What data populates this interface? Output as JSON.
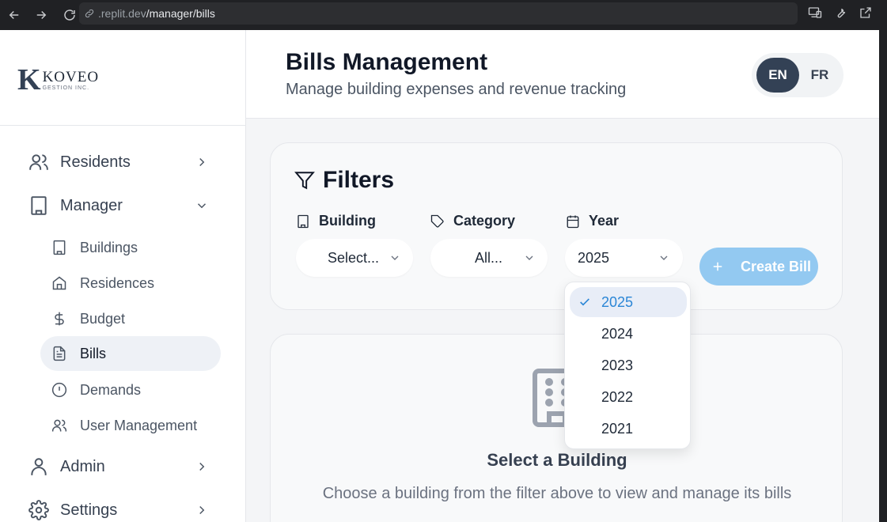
{
  "browser": {
    "url_host": ".replit.dev",
    "url_path": "/manager/bills"
  },
  "logo": {
    "mark": "K",
    "name": "KOVEO",
    "sub": "GESTION INC."
  },
  "sidebar": {
    "sections": [
      {
        "label": "Residents",
        "icon": "users-icon",
        "expanded": false
      },
      {
        "label": "Manager",
        "icon": "building-icon",
        "expanded": true
      },
      {
        "label": "Admin",
        "icon": "user-icon",
        "expanded": false
      },
      {
        "label": "Settings",
        "icon": "gear-icon",
        "expanded": false
      }
    ],
    "manager_items": [
      {
        "label": "Buildings",
        "icon": "building-icon",
        "active": false
      },
      {
        "label": "Residences",
        "icon": "home-icon",
        "active": false
      },
      {
        "label": "Budget",
        "icon": "dollar-icon",
        "active": false
      },
      {
        "label": "Bills",
        "icon": "file-text-icon",
        "active": true
      },
      {
        "label": "Demands",
        "icon": "alert-circle-icon",
        "active": false
      },
      {
        "label": "User Management",
        "icon": "users-icon",
        "active": false
      }
    ]
  },
  "header": {
    "title": "Bills Management",
    "subtitle": "Manage building expenses and revenue tracking",
    "lang_en": "EN",
    "lang_fr": "FR",
    "active_lang": "EN"
  },
  "filters": {
    "title": "Filters",
    "building_label": "Building",
    "building_value": "Select...",
    "category_label": "Category",
    "category_value": "All...",
    "year_label": "Year",
    "year_value": "2025",
    "create_button": "Create Bill"
  },
  "year_dropdown": {
    "options": [
      "2025",
      "2024",
      "2023",
      "2022",
      "2021"
    ],
    "selected": "2025"
  },
  "empty_state": {
    "title": "Select a Building",
    "description": "Choose a building from the filter above to view and manage its bills"
  },
  "colors": {
    "accent": "#2b86d6",
    "create_button_bg": "#93c9f1",
    "lang_active_bg": "#334155"
  }
}
